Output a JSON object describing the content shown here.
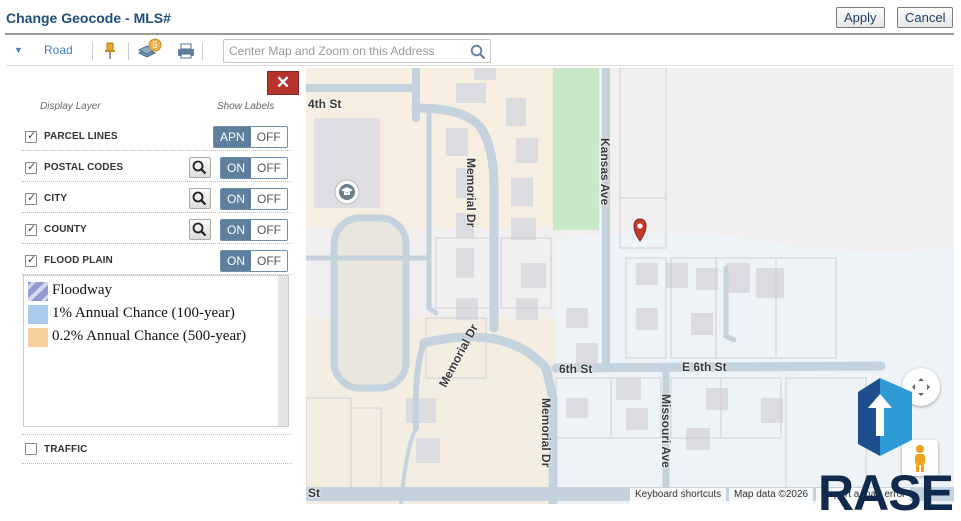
{
  "header": {
    "title": "Change Geocode - MLS#",
    "apply_label": "Apply",
    "cancel_label": "Cancel"
  },
  "toolbar": {
    "map_type": "Road",
    "badge_count": "5",
    "search_placeholder": "Center Map and Zoom on this Address",
    "icons": [
      "caret-down-icon",
      "pushpin-icon",
      "layers-icon",
      "print-icon",
      "search-icon"
    ]
  },
  "layers_panel": {
    "close_label": "✕",
    "col_display": "Display Layer",
    "col_labels": "Show Labels",
    "layers": [
      {
        "name": "PARCEL LINES",
        "checked": true,
        "on_label": "APN",
        "off_label": "OFF"
      },
      {
        "name": "POSTAL CODES",
        "checked": true,
        "on_label": "ON",
        "off_label": "OFF"
      },
      {
        "name": "CITY",
        "checked": true,
        "on_label": "ON",
        "off_label": "OFF"
      },
      {
        "name": "COUNTY",
        "checked": true,
        "on_label": "ON",
        "off_label": "OFF"
      },
      {
        "name": "FLOOD PLAIN",
        "checked": true,
        "on_label": "ON",
        "off_label": "OFF"
      }
    ],
    "legend": [
      {
        "label": "Floodway",
        "color": "#8f9ccf"
      },
      {
        "label": "1% Annual Chance (100-year)",
        "color": "#a9cbec"
      },
      {
        "label": "0.2% Annual Chance (500-year)",
        "color": "#f5cf9c"
      }
    ],
    "traffic": {
      "name": "TRAFFIC",
      "checked": false
    }
  },
  "map": {
    "streets": {
      "e_4th": "4th St",
      "memorial_1": "Memorial Dr",
      "kansas": "Kansas Ave",
      "memorial_2": "Memorial Dr",
      "w_6th": "6th St",
      "e_6th": "E 6th St",
      "memorial_3": "Memorial Dr",
      "missouri": "Missouri Ave",
      "bottom": "St"
    },
    "attribution": {
      "shortcuts": "Keyboard shortcuts",
      "data": "Map data ©2026",
      "report": "Report a map error"
    },
    "logo_text": "RASE",
    "colors": {
      "accent": "#5f7f9f",
      "close": "#b5332b",
      "park": "#c9e8c8",
      "marker": "#c0392b",
      "road": "#c4d2de"
    }
  }
}
